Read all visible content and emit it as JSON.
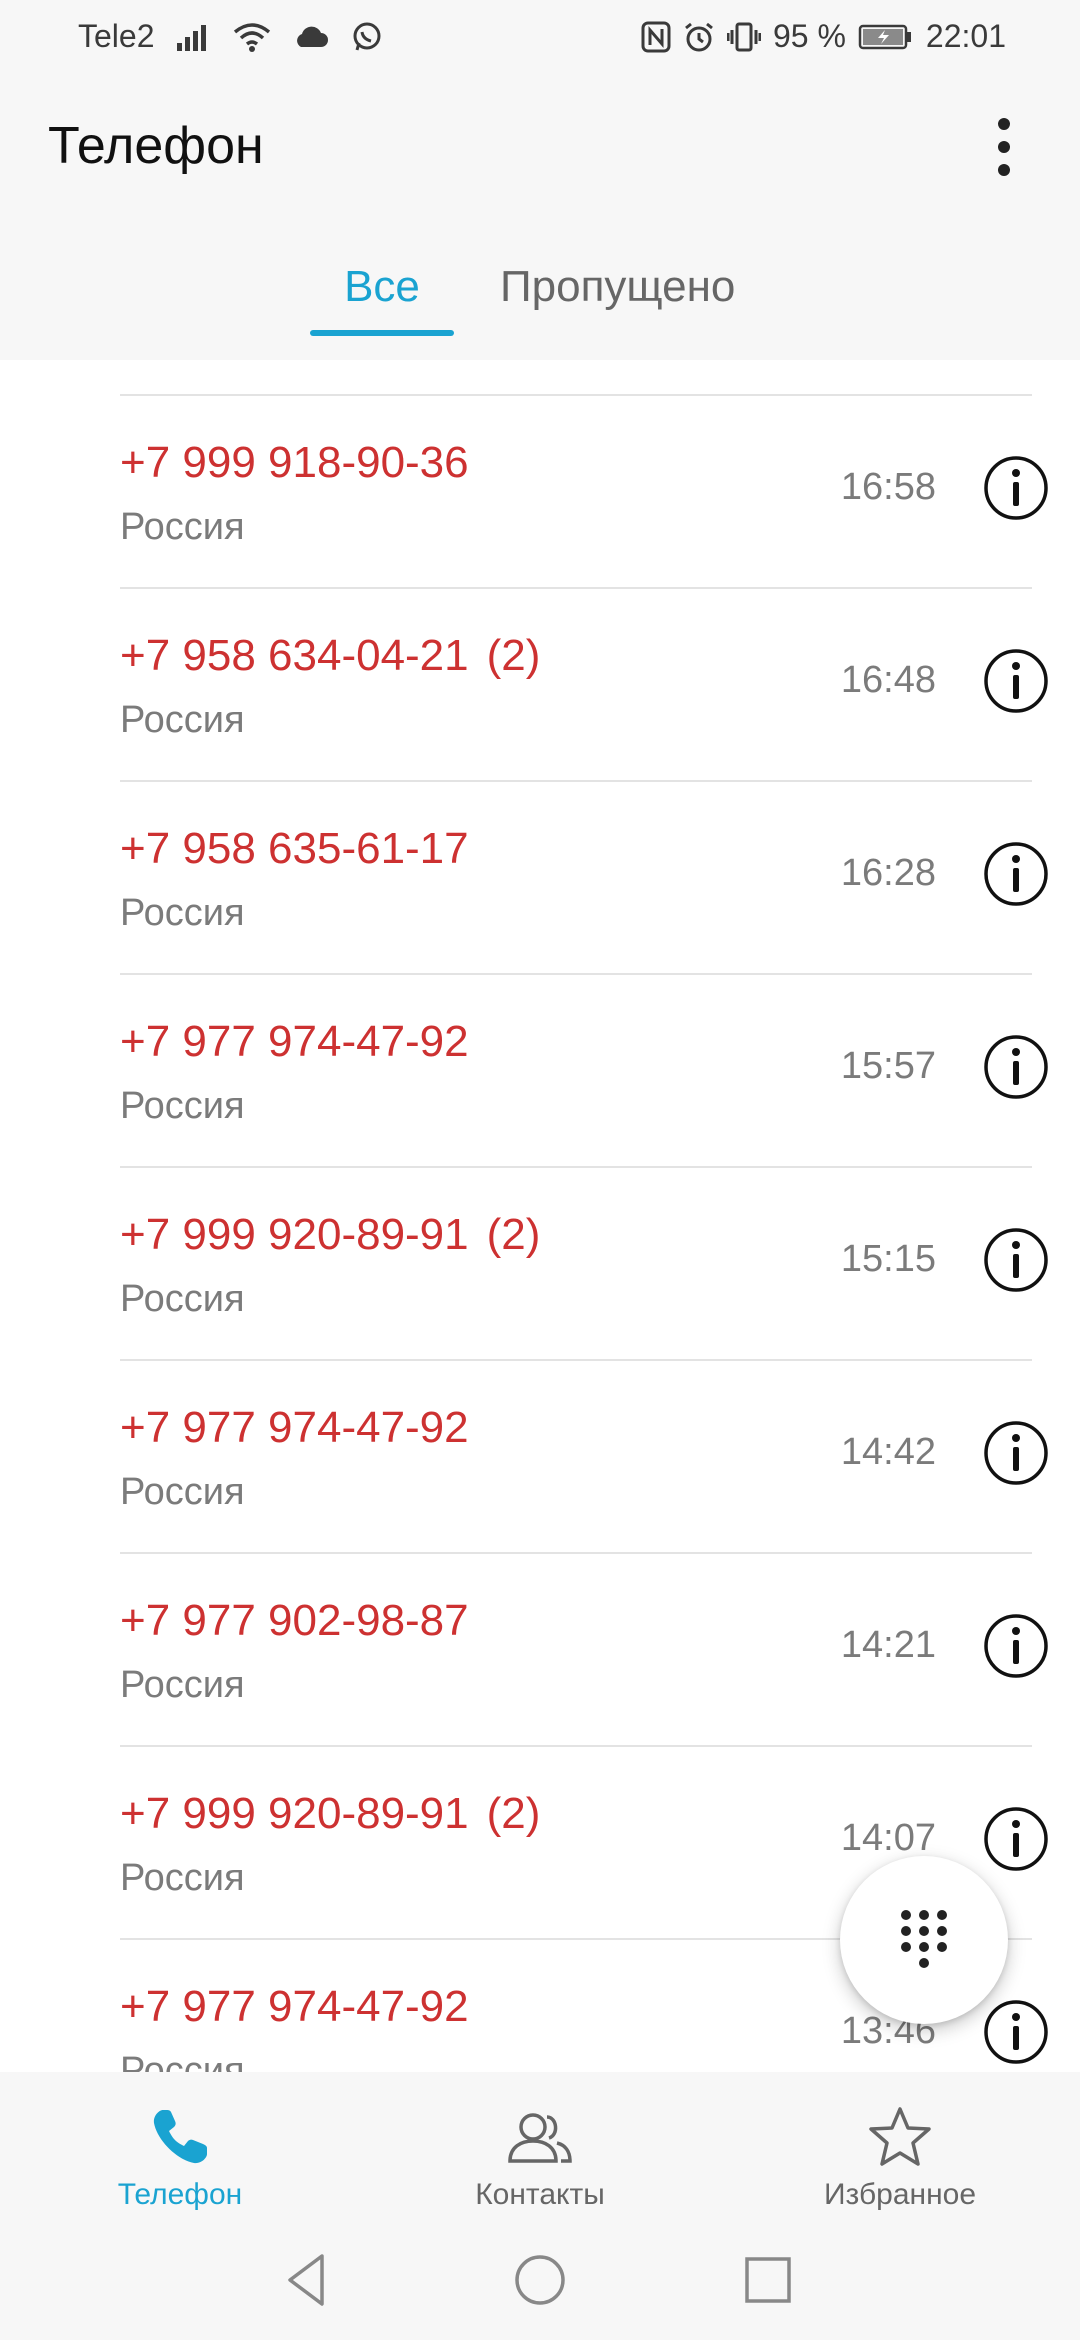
{
  "status_bar": {
    "carrier": "Tele2",
    "battery": "95 %",
    "time": "22:01"
  },
  "app_bar": {
    "title": "Телефон"
  },
  "tabs": [
    {
      "label": "Все",
      "active": true
    },
    {
      "label": "Пропущено",
      "active": false
    }
  ],
  "calls": [
    {
      "number": "+7 999 918-90-36",
      "count": "",
      "region": "Россия",
      "time": "16:58"
    },
    {
      "number": "+7 958 634-04-21",
      "count": "(2)",
      "region": "Россия",
      "time": "16:48"
    },
    {
      "number": "+7 958 635-61-17",
      "count": "",
      "region": "Россия",
      "time": "16:28"
    },
    {
      "number": "+7 977 974-47-92",
      "count": "",
      "region": "Россия",
      "time": "15:57"
    },
    {
      "number": "+7 999 920-89-91",
      "count": "(2)",
      "region": "Россия",
      "time": "15:15"
    },
    {
      "number": "+7 977 974-47-92",
      "count": "",
      "region": "Россия",
      "time": "14:42"
    },
    {
      "number": "+7 977 902-98-87",
      "count": "",
      "region": "Россия",
      "time": "14:21"
    },
    {
      "number": "+7 999 920-89-91",
      "count": "(2)",
      "region": "Россия",
      "time": "14:07"
    },
    {
      "number": "+7 977 974-47-92",
      "count": "",
      "region": "Россия",
      "time": "13:46"
    }
  ],
  "bottom_nav": [
    {
      "label": "Телефон",
      "icon": "phone-icon",
      "active": true
    },
    {
      "label": "Контакты",
      "icon": "contacts-icon",
      "active": false
    },
    {
      "label": "Избранное",
      "icon": "star-icon",
      "active": false
    }
  ],
  "colors": {
    "accent": "#1aa3d1",
    "missed_call": "#cd3131",
    "secondary_text": "#7b7b7b"
  }
}
